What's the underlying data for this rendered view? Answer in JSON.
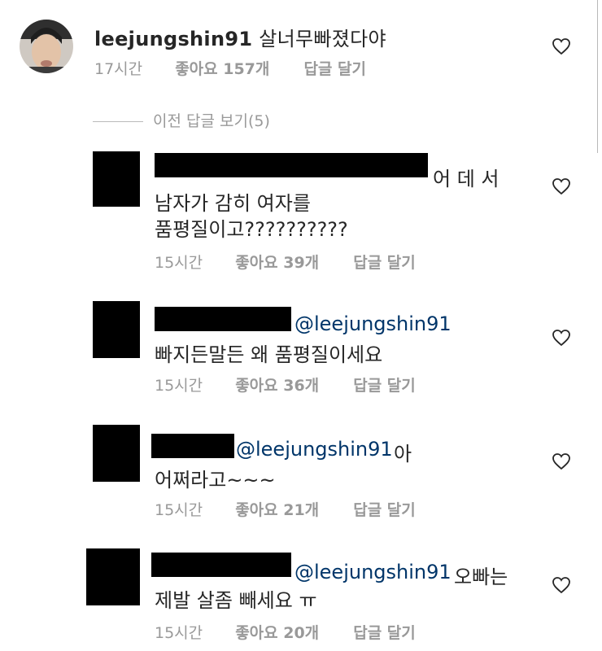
{
  "post": {
    "username": "leejungshin91",
    "text": "살너무빠졌다야",
    "time": "17시간",
    "likes": "좋아요 157개",
    "reply_label": "답글 달기"
  },
  "view_previous_label": "이전 답글 보기(5)",
  "replies": [
    {
      "line1_suffix": "어 데 서",
      "line2": "남자가 감히 여자를",
      "line3": "품평질이고??????????",
      "time": "15시간",
      "likes": "좋아요 39개",
      "reply_label": "답글 달기"
    },
    {
      "mention": "@leejungshin91",
      "line2": "빠지든말든 왜 품평질이세요",
      "time": "15시간",
      "likes": "좋아요 36개",
      "reply_label": "답글 달기"
    },
    {
      "mention": "@leejungshin91",
      "line1_suffix": "아",
      "line2": "어쩌라고~~~",
      "time": "15시간",
      "likes": "좋아요 21개",
      "reply_label": "답글 달기"
    },
    {
      "mention": "@leejungshin91",
      "line1_suffix": "오빠는",
      "line2": "제발 살좀 빼세요 ㅠ",
      "time": "15시간",
      "likes": "좋아요 20개",
      "reply_label": "답글 달기"
    }
  ],
  "icons": {
    "like": "heart-outline-icon"
  },
  "colors": {
    "mention": "#003569",
    "meta_text": "#999999",
    "redaction": "#000000"
  }
}
